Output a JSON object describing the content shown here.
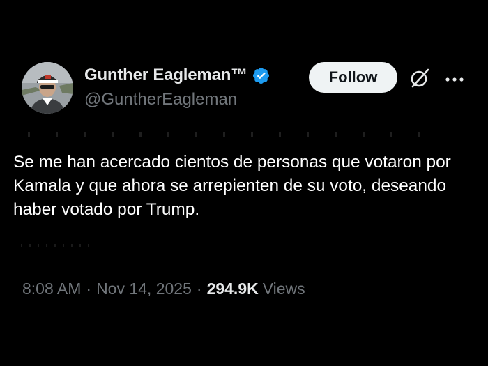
{
  "author": {
    "display_name": "Gunther Eagleman™",
    "handle": "@GuntherEagleman",
    "verified": true,
    "avatar_icon": "user-avatar-photo"
  },
  "actions": {
    "follow_label": "Follow",
    "grok_icon": "slashed-circle-icon",
    "more_icon": "more-dots-icon"
  },
  "post": {
    "text": "Se me han acercado cientos de personas que votaron por Kamala y que ahora se arrepienten de su voto, deseando haber votado por Trump."
  },
  "meta": {
    "time": "8:08 AM",
    "separator": "·",
    "date": "Nov 14, 2025",
    "views_count": "294.9K",
    "views_label": "Views"
  },
  "colors": {
    "background": "#000000",
    "primary_text": "#e7e9ea",
    "secondary_text": "#71767b",
    "verified_blue": "#1d9bf0",
    "follow_bg": "#eff3f4",
    "follow_text": "#0f1419"
  }
}
